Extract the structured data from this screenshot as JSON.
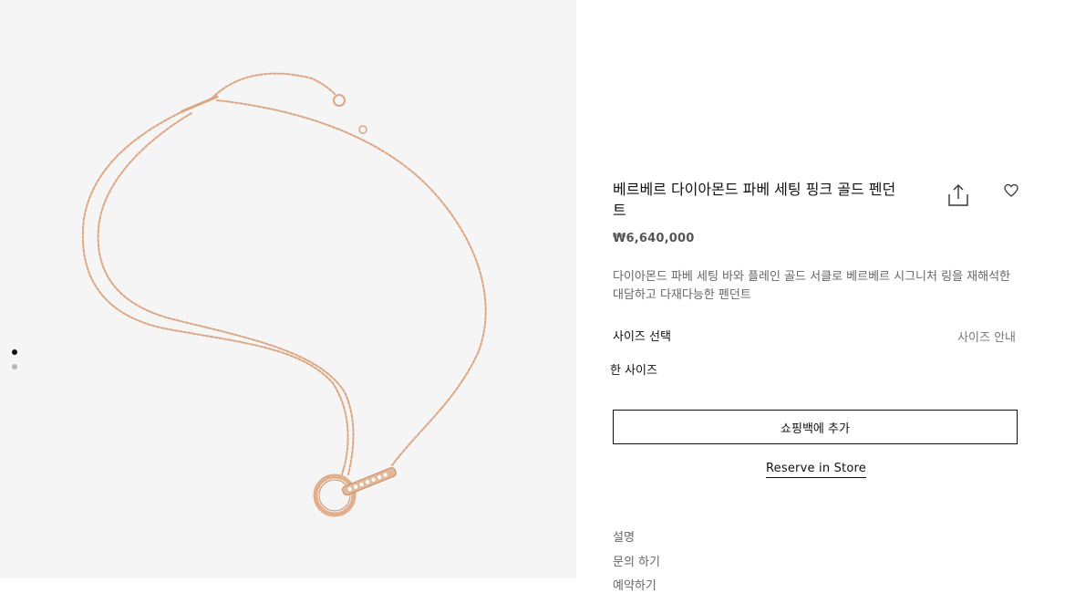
{
  "gallery": {
    "image_alt": "necklace-photo",
    "dots_total": 2,
    "active_index": 1
  },
  "product": {
    "title": "베르베르 다이아몬드 파베 세팅 핑크 골드 펜던트",
    "price": "₩6,640,000",
    "description": "다이아몬드 파베 세팅 바와 플레인 골드 서클로 베르베르 시그니처 링을 재해석한 대담하고 다재다능한 펜던트"
  },
  "size": {
    "label": "사이즈 선택",
    "guide": "사이즈 안내",
    "value": "한 사이즈"
  },
  "actions": {
    "add_to_bag": "쇼핑백에 추가",
    "reserve": "Reserve in Store"
  },
  "accordion": {
    "items": [
      "설명",
      "문의 하기",
      "예약하기"
    ]
  },
  "colors": {
    "gallery_bg": "#f5f5f5",
    "gold": "#d9a27e",
    "text": "#111111",
    "muted": "#666666"
  },
  "icons": [
    "share-icon",
    "heart-icon"
  ]
}
